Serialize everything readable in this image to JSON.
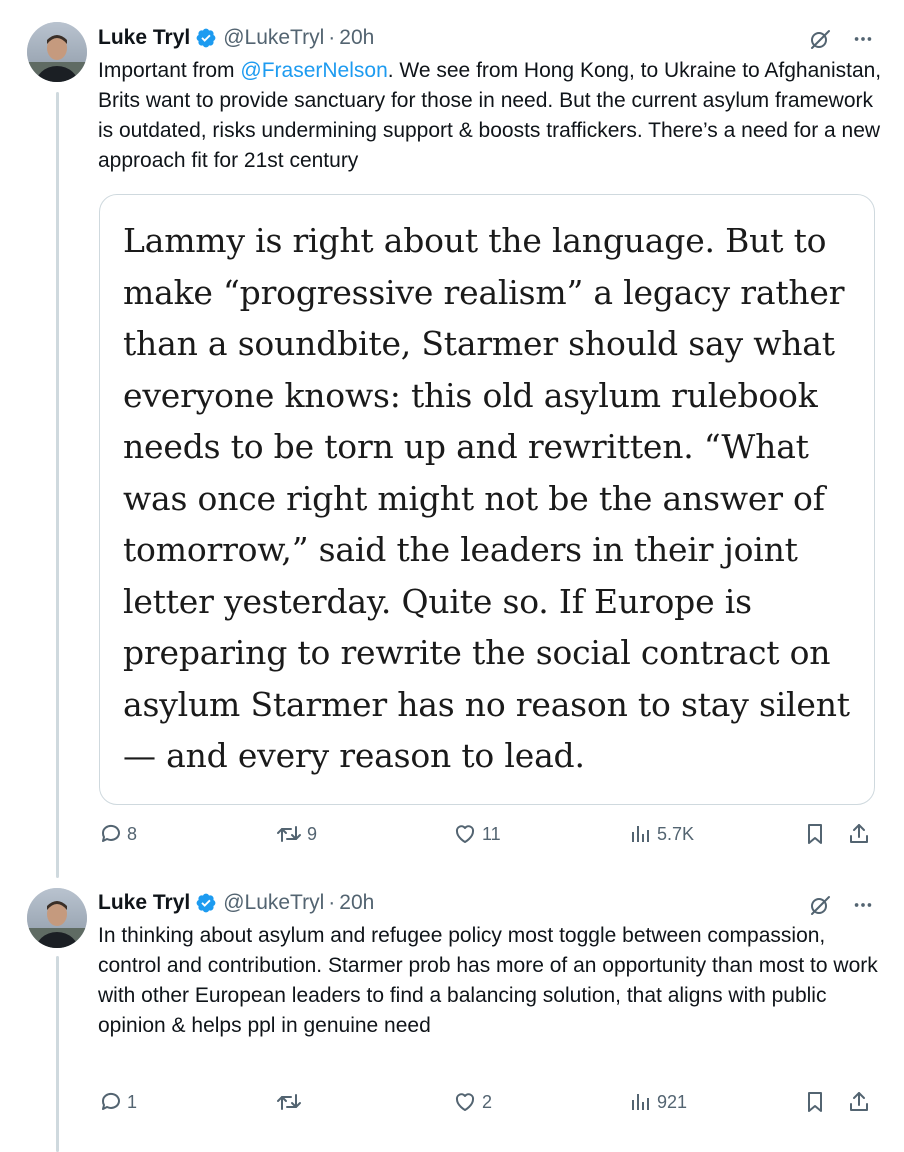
{
  "tweets": [
    {
      "author_name": "Luke Tryl",
      "handle": "@LukeTryl",
      "separator": "·",
      "time": "20h",
      "text_mention": "@FraserNelson",
      "text_before": "Important from ",
      "text_after": ". We see from Hong Kong, to Ukraine to Afghanistan, Brits want to provide sanctuary for those in need. But the current asylum framework is outdated, risks undermining support & boosts traffickers. There’s a need for a new approach fit for 21st century",
      "quote_text": "Lammy is right about the language. But to make “progressive realism” a legacy rather than a soundbite, Starmer should say what everyone knows: this old asylum rulebook needs to be torn up and rewritten. “What was once right might not be the answer of tomorrow,” said the leaders in their joint letter yesterday. Quite so. If Europe is preparing to rewrite the social contract on asylum Starmer has no reason to stay silent — and every reason to lead.",
      "actions": {
        "replies": "8",
        "reposts": "9",
        "likes": "11",
        "views": "5.7K"
      }
    },
    {
      "author_name": "Luke Tryl",
      "handle": "@LukeTryl",
      "separator": "·",
      "time": "20h",
      "text": "In thinking about asylum and refugee policy most toggle between compassion, control and contribution. Starmer prob has more of an opportunity than most to work with other European leaders to find a balancing solution, that aligns with public opinion & helps ppl in genuine need",
      "actions": {
        "replies": "1",
        "reposts": "",
        "likes": "2",
        "views": "921"
      }
    }
  ],
  "icons": {
    "verified": "verified-badge-icon",
    "grok": "grok-icon",
    "more": "more-icon",
    "reply": "reply-icon",
    "repost": "repost-icon",
    "like": "like-icon",
    "views": "views-icon",
    "bookmark": "bookmark-icon",
    "share": "share-icon"
  },
  "colors": {
    "accent": "#1d9bf0",
    "text": "#0f1419",
    "secondary": "#536471",
    "border": "#cfd9de"
  }
}
